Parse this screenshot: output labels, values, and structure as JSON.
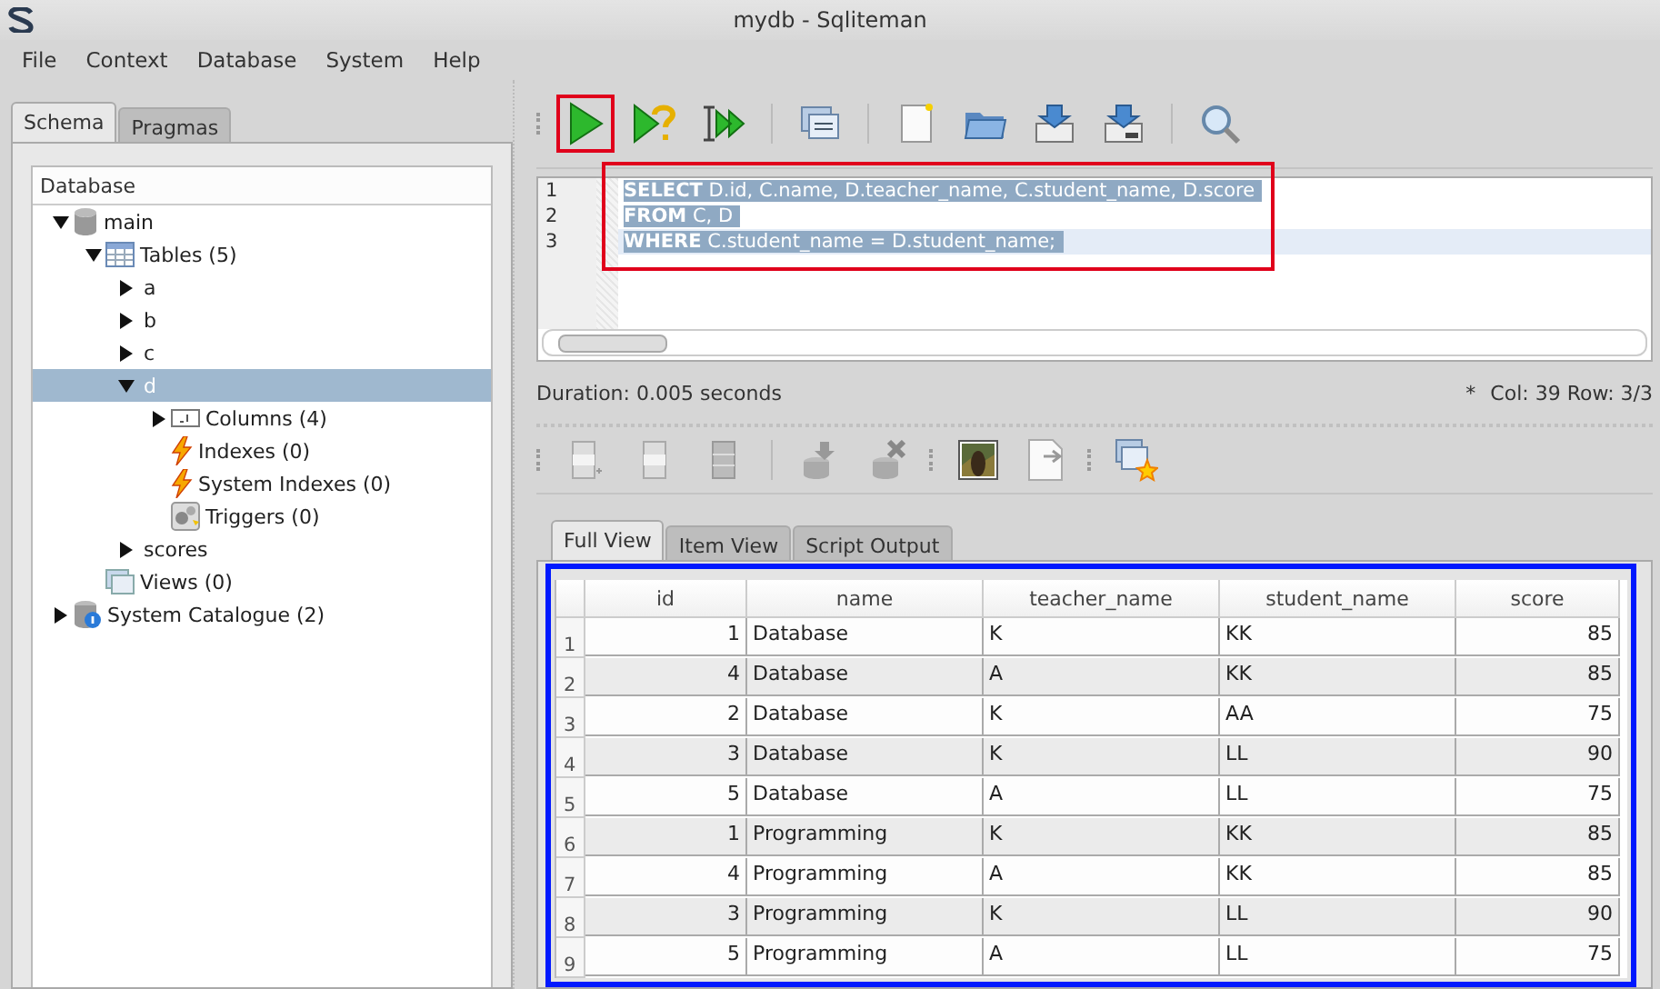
{
  "window": {
    "title": "mydb - Sqliteman"
  },
  "menu": [
    "File",
    "Context",
    "Database",
    "System",
    "Help"
  ],
  "left_tabs": [
    {
      "label": "Schema",
      "selected": true
    },
    {
      "label": "Pragmas",
      "selected": false
    }
  ],
  "tree": {
    "header": "Database",
    "items": [
      {
        "label": "main",
        "kind": "database",
        "expanded": true,
        "selected": false,
        "children": [
          {
            "label": "Tables (5)",
            "kind": "tables",
            "expanded": true,
            "selected": false,
            "children": [
              {
                "label": "a",
                "expanded": false,
                "selected": false
              },
              {
                "label": "b",
                "expanded": false,
                "selected": false
              },
              {
                "label": "c",
                "expanded": false,
                "selected": false
              },
              {
                "label": "d",
                "expanded": true,
                "selected": true,
                "children": [
                  {
                    "label": "Columns (4)",
                    "kind": "columns",
                    "expanded": false,
                    "selected": false
                  },
                  {
                    "label": "Indexes (0)",
                    "kind": "indexes",
                    "selected": false
                  },
                  {
                    "label": "System Indexes (0)",
                    "kind": "indexes",
                    "selected": false
                  },
                  {
                    "label": "Triggers (0)",
                    "kind": "triggers",
                    "selected": false
                  }
                ]
              },
              {
                "label": "scores",
                "expanded": false,
                "selected": false
              }
            ]
          },
          {
            "label": "Views (0)",
            "kind": "views",
            "selected": false
          }
        ]
      },
      {
        "label": "System Catalogue (2)",
        "kind": "catalogue",
        "expanded": false,
        "selected": false
      }
    ]
  },
  "editor": {
    "lines": [
      {
        "number": "1",
        "code": "**SELECT** D.id, C.name, D.teacher_name, C.student_name, D.score",
        "current": false
      },
      {
        "number": "2",
        "code": "**FROM** C, D",
        "current": false
      },
      {
        "number": "3",
        "code": "**WHERE** C.student_name = D.student_name;",
        "current": true
      }
    ]
  },
  "status": {
    "message": "Duration: 0.005 seconds",
    "modified": "*",
    "position": "Col: 39 Row: 3/3"
  },
  "result_tabs": [
    {
      "label": "Full View",
      "selected": true
    },
    {
      "label": "Item View",
      "selected": false
    },
    {
      "label": "Script Output",
      "selected": false
    }
  ],
  "table": {
    "columns": [
      "id",
      "name",
      "teacher_name",
      "student_name",
      "score"
    ],
    "rows": [
      {
        "number": "1",
        "cells": [
          "1",
          "Database",
          "K",
          "KK",
          "85"
        ]
      },
      {
        "number": "2",
        "cells": [
          "4",
          "Database",
          "A",
          "KK",
          "85"
        ]
      },
      {
        "number": "3",
        "cells": [
          "2",
          "Database",
          "K",
          "AA",
          "75"
        ]
      },
      {
        "number": "4",
        "cells": [
          "3",
          "Database",
          "K",
          "LL",
          "90"
        ]
      },
      {
        "number": "5",
        "cells": [
          "5",
          "Database",
          "A",
          "LL",
          "75"
        ]
      },
      {
        "number": "6",
        "cells": [
          "1",
          "Programming",
          "K",
          "KK",
          "85"
        ]
      },
      {
        "number": "7",
        "cells": [
          "4",
          "Programming",
          "A",
          "KK",
          "85"
        ]
      },
      {
        "number": "8",
        "cells": [
          "3",
          "Programming",
          "K",
          "LL",
          "90"
        ]
      },
      {
        "number": "9",
        "cells": [
          "5",
          "Programming",
          "A",
          "LL",
          "75"
        ]
      }
    ]
  }
}
